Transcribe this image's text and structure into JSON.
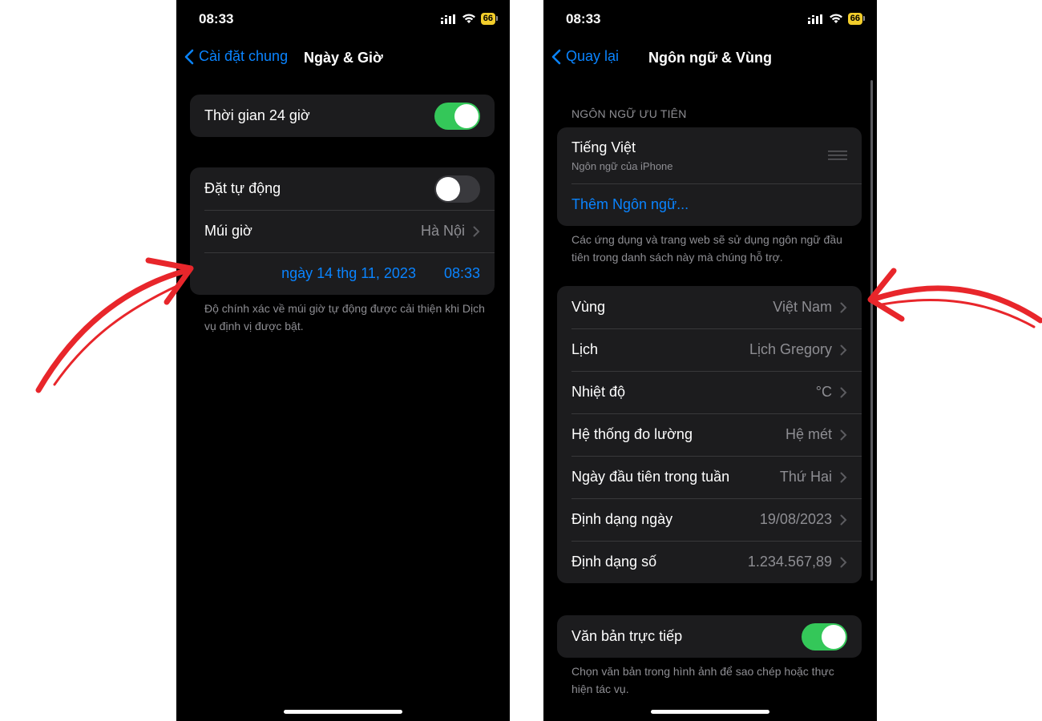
{
  "left": {
    "status": {
      "time": "08:33",
      "battery": "66"
    },
    "nav": {
      "back_label": "Cài đặt chung",
      "title": "Ngày & Giờ"
    },
    "toggle_24h": {
      "label": "Thời gian 24 giờ",
      "on": true
    },
    "auto": {
      "label": "Đặt tự động",
      "on": false
    },
    "timezone": {
      "label": "Múi giờ",
      "value": "Hà Nội"
    },
    "datetime": {
      "date": "ngày 14 thg 11, 2023",
      "time": "08:33"
    },
    "footnote": "Độ chính xác về múi giờ tự động được cải thiện khi Dịch vụ định vị được bật."
  },
  "right": {
    "status": {
      "time": "08:33",
      "battery": "66"
    },
    "nav": {
      "back_label": "Quay lại",
      "title": "Ngôn ngữ & Vùng"
    },
    "languages": {
      "header": "NGÔN NGỮ ƯU TIÊN",
      "primary": {
        "name": "Tiếng Việt",
        "subtitle": "Ngôn ngữ của iPhone"
      },
      "add_label": "Thêm Ngôn ngữ...",
      "footnote": "Các ứng dụng và trang web sẽ sử dụng ngôn ngữ đầu tiên trong danh sách này mà chúng hỗ trợ."
    },
    "region_rows": [
      {
        "label": "Vùng",
        "value": "Việt Nam"
      },
      {
        "label": "Lịch",
        "value": "Lịch Gregory"
      },
      {
        "label": "Nhiệt độ",
        "value": "°C"
      },
      {
        "label": "Hệ thống đo lường",
        "value": "Hệ mét"
      },
      {
        "label": "Ngày đầu tiên trong tuần",
        "value": "Thứ Hai"
      },
      {
        "label": "Định dạng ngày",
        "value": "19/08/2023"
      },
      {
        "label": "Định dạng số",
        "value": "1.234.567,89"
      }
    ],
    "live_text": {
      "label": "Văn bản trực tiếp",
      "on": true
    },
    "live_text_footnote": "Chọn văn bản trong hình ảnh để sao chép hoặc thực hiện tác vụ."
  },
  "colors": {
    "accent": "#0a84ff",
    "toggle_on": "#34c759",
    "arrow": "#e8262b",
    "battery": "#f2cd2b"
  }
}
